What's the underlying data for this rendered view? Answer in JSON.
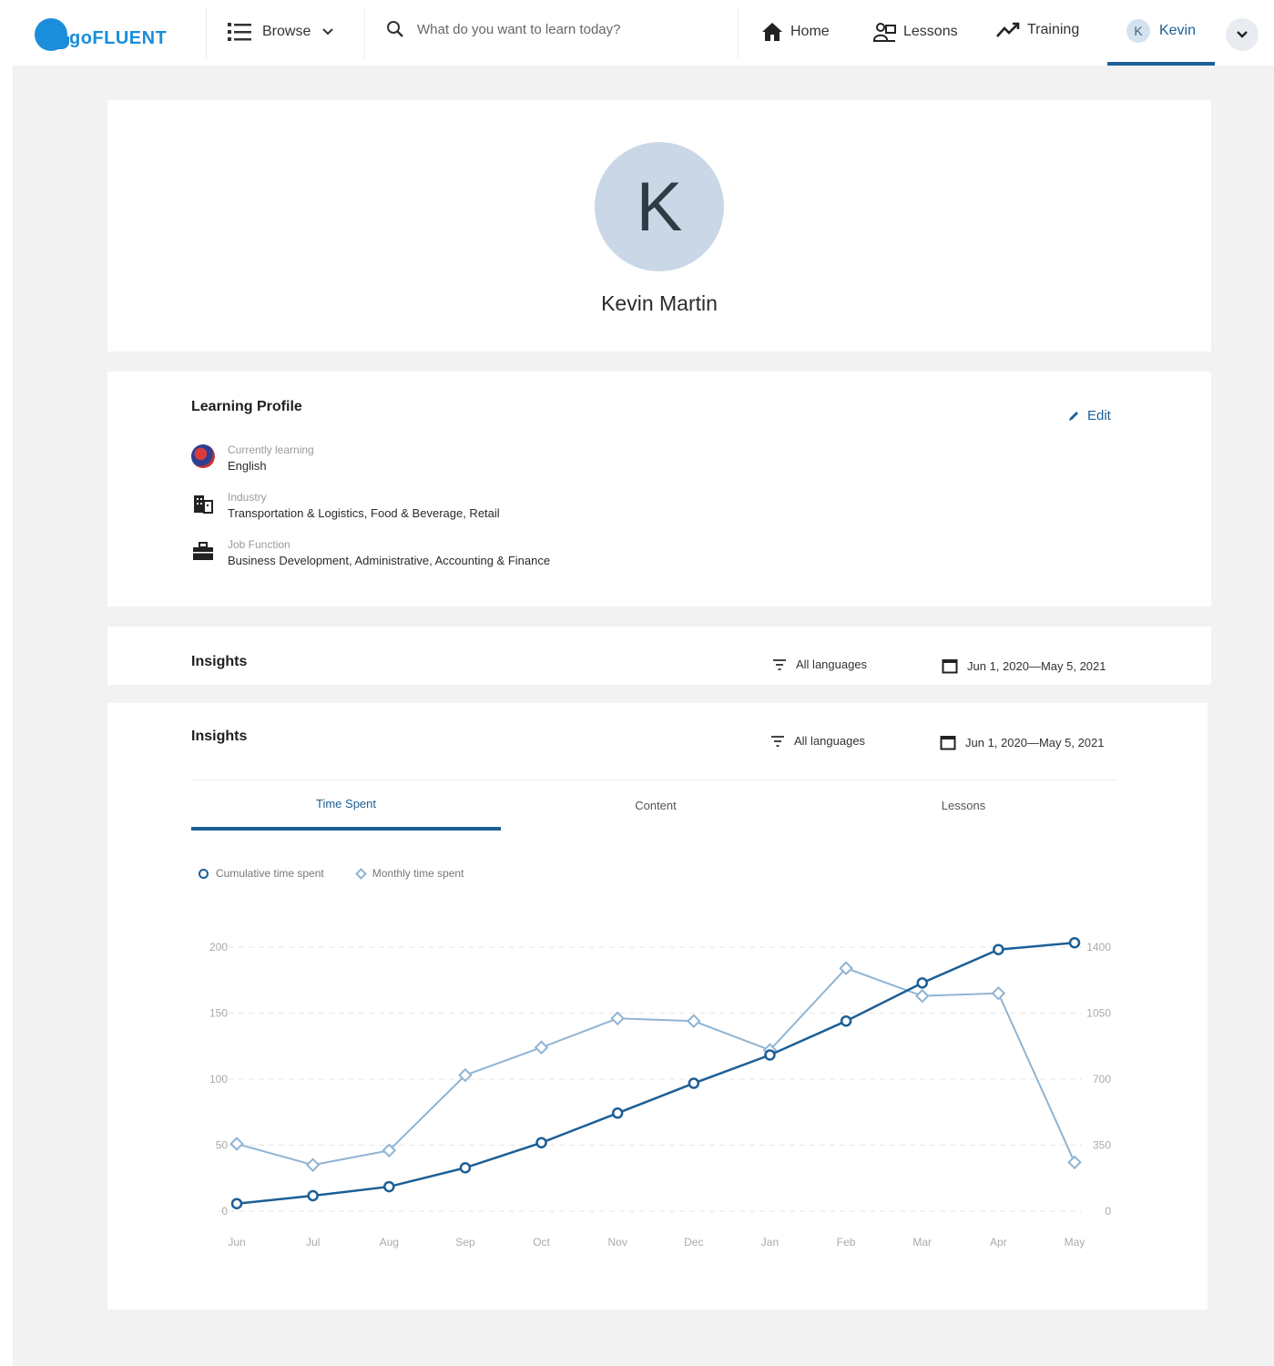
{
  "brand": {
    "name": "goFLUENT",
    "color": "#1a8ddb"
  },
  "nav": {
    "browse_label": "Browse",
    "search_placeholder": "What do you want to learn today?",
    "home_label": "Home",
    "lessons_label": "Lessons",
    "training_label": "Training",
    "user_initial": "K",
    "user_label": "Kevin"
  },
  "profile": {
    "initial": "K",
    "name": "Kevin Martin"
  },
  "learning_profile": {
    "title": "Learning Profile",
    "edit_label": "Edit",
    "rows": [
      {
        "label": "Currently learning",
        "value": "English",
        "icon": "flag-icon"
      },
      {
        "label": "Industry",
        "value": "Transportation & Logistics, Food & Beverage, Retail",
        "icon": "building-icon"
      },
      {
        "label": "Job Function",
        "value": "Business Development, Administrative, Accounting & Finance",
        "icon": "briefcase-icon"
      }
    ]
  },
  "insights_strip": {
    "title": "Insights",
    "language_filter": "All languages",
    "date_range": "Jun 1, 2020—May 5, 2021"
  },
  "insights": {
    "title": "Insights",
    "language_filter": "All languages",
    "date_range": "Jun 1, 2020—May 5, 2021",
    "tabs": [
      "Time Spent",
      "Content",
      "Lessons"
    ],
    "active_tab": 0,
    "legend": [
      "Cumulative time spent",
      "Monthly time spent"
    ]
  },
  "colors": {
    "accent": "#1c5f96",
    "light_series": "#8fb4d3"
  },
  "chart_data": {
    "type": "line",
    "categories": [
      "Jun",
      "Jul",
      "Aug",
      "Sep",
      "Oct",
      "Nov",
      "Dec",
      "Jan",
      "Feb",
      "Mar",
      "Apr",
      "May"
    ],
    "y_left": {
      "ticks": [
        0,
        50,
        100,
        150,
        200
      ],
      "range": [
        0,
        200
      ]
    },
    "y_right": {
      "ticks": [
        0,
        350,
        700,
        1050,
        1400
      ],
      "range": [
        0,
        1400
      ]
    },
    "grid": true,
    "series": [
      {
        "name": "Cumulative time spent",
        "axis": "right",
        "values": [
          40,
          82,
          130,
          230,
          363,
          520,
          678,
          828,
          1008,
          1210,
          1387,
          1423
        ]
      },
      {
        "name": "Monthly time spent",
        "axis": "left",
        "values": [
          51,
          35,
          46,
          103,
          124,
          146,
          144,
          122,
          184,
          163,
          165,
          37
        ]
      }
    ]
  }
}
